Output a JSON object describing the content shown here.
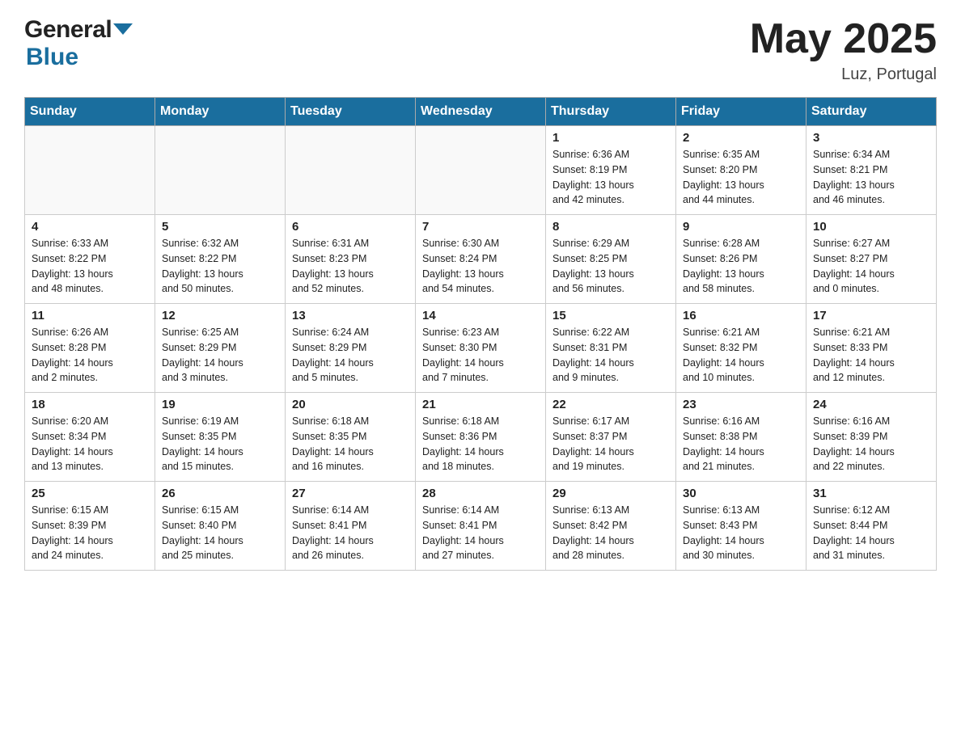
{
  "header": {
    "logo_line1": "General",
    "logo_line2": "Blue",
    "title": "May 2025",
    "location": "Luz, Portugal"
  },
  "weekdays": [
    "Sunday",
    "Monday",
    "Tuesday",
    "Wednesday",
    "Thursday",
    "Friday",
    "Saturday"
  ],
  "weeks": [
    [
      {
        "day": "",
        "info": ""
      },
      {
        "day": "",
        "info": ""
      },
      {
        "day": "",
        "info": ""
      },
      {
        "day": "",
        "info": ""
      },
      {
        "day": "1",
        "info": "Sunrise: 6:36 AM\nSunset: 8:19 PM\nDaylight: 13 hours\nand 42 minutes."
      },
      {
        "day": "2",
        "info": "Sunrise: 6:35 AM\nSunset: 8:20 PM\nDaylight: 13 hours\nand 44 minutes."
      },
      {
        "day": "3",
        "info": "Sunrise: 6:34 AM\nSunset: 8:21 PM\nDaylight: 13 hours\nand 46 minutes."
      }
    ],
    [
      {
        "day": "4",
        "info": "Sunrise: 6:33 AM\nSunset: 8:22 PM\nDaylight: 13 hours\nand 48 minutes."
      },
      {
        "day": "5",
        "info": "Sunrise: 6:32 AM\nSunset: 8:22 PM\nDaylight: 13 hours\nand 50 minutes."
      },
      {
        "day": "6",
        "info": "Sunrise: 6:31 AM\nSunset: 8:23 PM\nDaylight: 13 hours\nand 52 minutes."
      },
      {
        "day": "7",
        "info": "Sunrise: 6:30 AM\nSunset: 8:24 PM\nDaylight: 13 hours\nand 54 minutes."
      },
      {
        "day": "8",
        "info": "Sunrise: 6:29 AM\nSunset: 8:25 PM\nDaylight: 13 hours\nand 56 minutes."
      },
      {
        "day": "9",
        "info": "Sunrise: 6:28 AM\nSunset: 8:26 PM\nDaylight: 13 hours\nand 58 minutes."
      },
      {
        "day": "10",
        "info": "Sunrise: 6:27 AM\nSunset: 8:27 PM\nDaylight: 14 hours\nand 0 minutes."
      }
    ],
    [
      {
        "day": "11",
        "info": "Sunrise: 6:26 AM\nSunset: 8:28 PM\nDaylight: 14 hours\nand 2 minutes."
      },
      {
        "day": "12",
        "info": "Sunrise: 6:25 AM\nSunset: 8:29 PM\nDaylight: 14 hours\nand 3 minutes."
      },
      {
        "day": "13",
        "info": "Sunrise: 6:24 AM\nSunset: 8:29 PM\nDaylight: 14 hours\nand 5 minutes."
      },
      {
        "day": "14",
        "info": "Sunrise: 6:23 AM\nSunset: 8:30 PM\nDaylight: 14 hours\nand 7 minutes."
      },
      {
        "day": "15",
        "info": "Sunrise: 6:22 AM\nSunset: 8:31 PM\nDaylight: 14 hours\nand 9 minutes."
      },
      {
        "day": "16",
        "info": "Sunrise: 6:21 AM\nSunset: 8:32 PM\nDaylight: 14 hours\nand 10 minutes."
      },
      {
        "day": "17",
        "info": "Sunrise: 6:21 AM\nSunset: 8:33 PM\nDaylight: 14 hours\nand 12 minutes."
      }
    ],
    [
      {
        "day": "18",
        "info": "Sunrise: 6:20 AM\nSunset: 8:34 PM\nDaylight: 14 hours\nand 13 minutes."
      },
      {
        "day": "19",
        "info": "Sunrise: 6:19 AM\nSunset: 8:35 PM\nDaylight: 14 hours\nand 15 minutes."
      },
      {
        "day": "20",
        "info": "Sunrise: 6:18 AM\nSunset: 8:35 PM\nDaylight: 14 hours\nand 16 minutes."
      },
      {
        "day": "21",
        "info": "Sunrise: 6:18 AM\nSunset: 8:36 PM\nDaylight: 14 hours\nand 18 minutes."
      },
      {
        "day": "22",
        "info": "Sunrise: 6:17 AM\nSunset: 8:37 PM\nDaylight: 14 hours\nand 19 minutes."
      },
      {
        "day": "23",
        "info": "Sunrise: 6:16 AM\nSunset: 8:38 PM\nDaylight: 14 hours\nand 21 minutes."
      },
      {
        "day": "24",
        "info": "Sunrise: 6:16 AM\nSunset: 8:39 PM\nDaylight: 14 hours\nand 22 minutes."
      }
    ],
    [
      {
        "day": "25",
        "info": "Sunrise: 6:15 AM\nSunset: 8:39 PM\nDaylight: 14 hours\nand 24 minutes."
      },
      {
        "day": "26",
        "info": "Sunrise: 6:15 AM\nSunset: 8:40 PM\nDaylight: 14 hours\nand 25 minutes."
      },
      {
        "day": "27",
        "info": "Sunrise: 6:14 AM\nSunset: 8:41 PM\nDaylight: 14 hours\nand 26 minutes."
      },
      {
        "day": "28",
        "info": "Sunrise: 6:14 AM\nSunset: 8:41 PM\nDaylight: 14 hours\nand 27 minutes."
      },
      {
        "day": "29",
        "info": "Sunrise: 6:13 AM\nSunset: 8:42 PM\nDaylight: 14 hours\nand 28 minutes."
      },
      {
        "day": "30",
        "info": "Sunrise: 6:13 AM\nSunset: 8:43 PM\nDaylight: 14 hours\nand 30 minutes."
      },
      {
        "day": "31",
        "info": "Sunrise: 6:12 AM\nSunset: 8:44 PM\nDaylight: 14 hours\nand 31 minutes."
      }
    ]
  ]
}
